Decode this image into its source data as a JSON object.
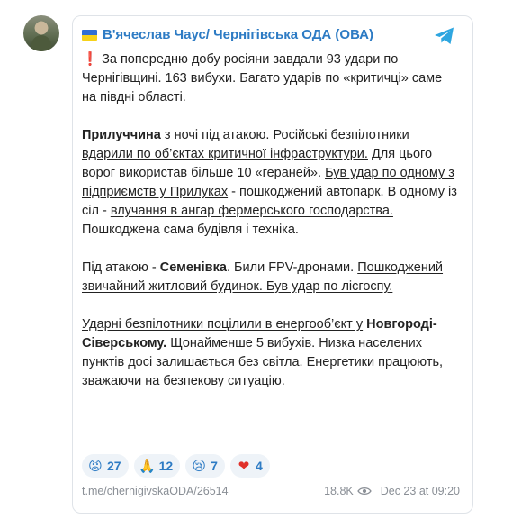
{
  "post": {
    "channel_name": "В'ячеслав Чаус/ Чернігівська ОДА (ОВА)",
    "p1": {
      "mark": "❗",
      "text": " За попередню добу росіяни завдали 93 удари по Чернігівщині. 163 вибухи. Багато ударів по «критичці» саме на півдні області."
    },
    "p2": {
      "bold1": "Прилуччина",
      "t1": " з ночі під атакою. ",
      "u1": "Російські безпілотники вдарили по об’єктах критичної інфраструктури.",
      "t2": " Для цього ворог використав більше 10 «гераней». ",
      "u2": "Був удар по одному з підприємств у Прилуках",
      "t3": " - пошкоджений автопарк. В одному із сіл - ",
      "u3": "влучання в ангар фермерського господарства.",
      "t4": " Пошкоджена сама будівля і техніка."
    },
    "p3": {
      "t1": "Під атакою - ",
      "bold1": "Семенівка",
      "t2": ". Били FPV-дронами. ",
      "u1": "Пошкоджений звичайний житловий будинок. Був удар по лісгоспу."
    },
    "p4": {
      "u1": "Ударні безпілотники поцілили в енергооб’єкт у",
      "t0": " ",
      "bold1": "Новгороді-Сіверському.",
      "t1": " Щонайменше 5 вибухів. Низка населених пунктів досі залишається без світла. Енергетики працюють, зважаючи на безпекову ситуацію."
    }
  },
  "reactions": [
    {
      "emoji": "😡",
      "count": "27"
    },
    {
      "emoji": "🙏",
      "count": "12"
    },
    {
      "emoji": "😢",
      "count": "7"
    },
    {
      "emoji": "❤",
      "count": "4"
    }
  ],
  "footer": {
    "link": "t.me/chernigivskaODA/26514",
    "views": "18.8K",
    "date": "Dec 23 at 09:20"
  },
  "colors": {
    "accent": "#2d7bc4",
    "telegram": "#2ea6e0",
    "heart": "#e0302a"
  }
}
